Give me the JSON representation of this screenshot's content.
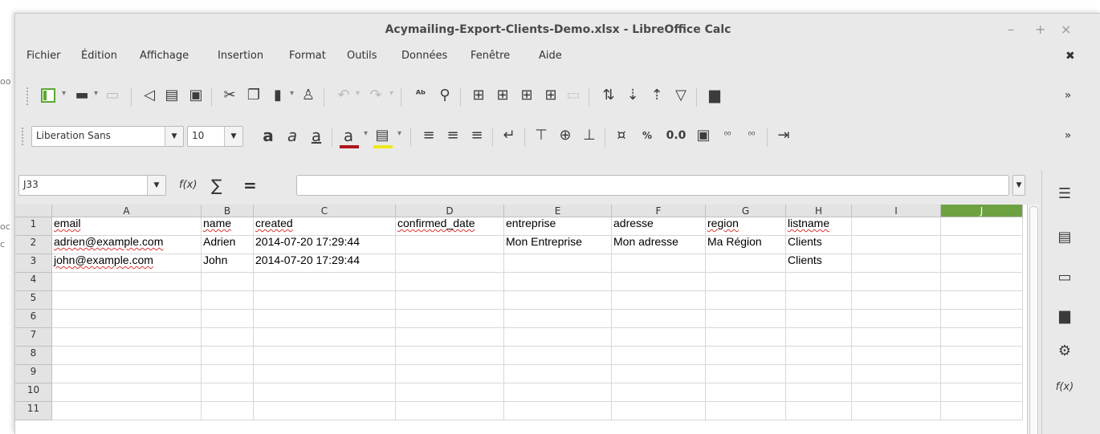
{
  "window": {
    "title": "Acymailing-Export-Clients-Demo.xlsx - LibreOffice Calc",
    "min": "–",
    "max": "+",
    "close": "×",
    "menu_close": "✖"
  },
  "menu": [
    "Fichier",
    "Édition",
    "Affichage",
    "Insertion",
    "Format",
    "Outils",
    "Données",
    "Fenêtre",
    "Aide"
  ],
  "formatting": {
    "font_name": "Liberation Sans",
    "font_size": "10",
    "bold": "a",
    "italic": "a",
    "underline": "a",
    "font_color": "a",
    "percent": "%",
    "number": "0.0"
  },
  "formula_bar": {
    "cell_ref": "J33",
    "fx_label": "f(x)",
    "sum_label": "∑",
    "equals_label": "=",
    "value": ""
  },
  "sheet": {
    "columns": [
      "A",
      "B",
      "C",
      "D",
      "E",
      "F",
      "G",
      "H",
      "I",
      "J"
    ],
    "selected_column": "J",
    "rows": [
      "1",
      "2",
      "3",
      "4",
      "5",
      "6",
      "7",
      "8",
      "9",
      "10",
      "11"
    ],
    "cells": [
      [
        "email",
        "name",
        "created",
        "confirmed_date",
        "entreprise",
        "adresse",
        "region",
        "listname",
        "",
        ""
      ],
      [
        "adrien@example.com",
        "Adrien",
        "2014-07-20 17:29:44",
        "",
        "Mon Entreprise",
        "Mon adresse",
        "Ma Région",
        "Clients",
        "",
        ""
      ],
      [
        "john@example.com",
        "John",
        "2014-07-20 17:29:44",
        "",
        "",
        "",
        "",
        "Clients",
        "",
        ""
      ]
    ]
  },
  "sidebar": {
    "functions_label": "f(x)"
  },
  "background_fragments": [
    "oo",
    "oc",
    "c"
  ],
  "colors": {
    "selected_column": "#6ea141",
    "font_color_bar": "#b0141e",
    "highlight_bar": "#f0e81e",
    "sheet_icon_green": "#5aa832"
  }
}
